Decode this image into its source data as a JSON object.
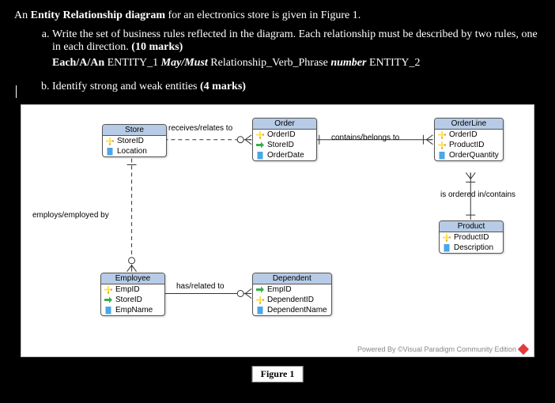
{
  "intro_prefix": "An ",
  "intro_bold": "Entity Relationship diagram",
  "intro_suffix": " for an electronics store is given in Figure 1.",
  "qa_text": "Write the set of business rules reflected in the diagram. Each relationship must be described by two rules, one in each direction. ",
  "qa_marks": "(10 marks)",
  "template_lead": "Each/A/An",
  "template_e1": " ENTITY_1 ",
  "template_verb_lead": "May/Must",
  "template_rest": " Relationship_Verb_Phrase ",
  "template_num": "number",
  "template_e2": " ENTITY_2",
  "qb_text": "Identify strong and weak entities ",
  "qb_marks": "(4 marks)",
  "chart_data": {
    "type": "diagram",
    "diagram_type": "Entity-Relationship",
    "title": "Figure 1",
    "entities": [
      {
        "name": "Store",
        "strength": "strong",
        "attributes": [
          {
            "name": "StoreID",
            "role": "PK"
          },
          {
            "name": "Location",
            "role": "attribute"
          }
        ]
      },
      {
        "name": "Order",
        "strength": "strong",
        "attributes": [
          {
            "name": "OrderID",
            "role": "PK"
          },
          {
            "name": "StoreID",
            "role": "FK"
          },
          {
            "name": "OrderDate",
            "role": "attribute"
          }
        ]
      },
      {
        "name": "OrderLine",
        "strength": "weak",
        "attributes": [
          {
            "name": "OrderID",
            "role": "PK/FK"
          },
          {
            "name": "ProductID",
            "role": "PK/FK"
          },
          {
            "name": "OrderQuantity",
            "role": "attribute"
          }
        ]
      },
      {
        "name": "Product",
        "strength": "strong",
        "attributes": [
          {
            "name": "ProductID",
            "role": "PK"
          },
          {
            "name": "Description",
            "role": "attribute"
          }
        ]
      },
      {
        "name": "Employee",
        "strength": "strong",
        "attributes": [
          {
            "name": "EmpID",
            "role": "PK"
          },
          {
            "name": "StoreID",
            "role": "FK"
          },
          {
            "name": "EmpName",
            "role": "attribute"
          }
        ]
      },
      {
        "name": "Dependent",
        "strength": "weak",
        "attributes": [
          {
            "name": "EmpID",
            "role": "PK/FK"
          },
          {
            "name": "DependentID",
            "role": "PK"
          },
          {
            "name": "DependentName",
            "role": "attribute"
          }
        ]
      }
    ],
    "relationships": [
      {
        "from": "Store",
        "to": "Order",
        "label": "receives/relates to",
        "identifying": false
      },
      {
        "from": "Order",
        "to": "OrderLine",
        "label": "contains/belongs to",
        "identifying": true
      },
      {
        "from": "Product",
        "to": "OrderLine",
        "label": "is ordered in/contains",
        "identifying": true
      },
      {
        "from": "Store",
        "to": "Employee",
        "label": "employs/employed by",
        "identifying": false
      },
      {
        "from": "Employee",
        "to": "Dependent",
        "label": "has/related to",
        "identifying": true
      }
    ]
  },
  "entities": {
    "store": {
      "name": "Store",
      "a0": "StoreID",
      "a1": "Location"
    },
    "order": {
      "name": "Order",
      "a0": "OrderID",
      "a1": "StoreID",
      "a2": "OrderDate"
    },
    "orderline": {
      "name": "OrderLine",
      "a0": "OrderID",
      "a1": "ProductID",
      "a2": "OrderQuantity"
    },
    "product": {
      "name": "Product",
      "a0": "ProductID",
      "a1": "Description"
    },
    "employee": {
      "name": "Employee",
      "a0": "EmpID",
      "a1": "StoreID",
      "a2": "EmpName"
    },
    "dependent": {
      "name": "Dependent",
      "a0": "EmpID",
      "a1": "DependentID",
      "a2": "DependentName"
    }
  },
  "rel_labels": {
    "store_order": "receives/relates to",
    "order_orderline": "contains/belongs to",
    "product_orderline": "is ordered in/contains",
    "store_employee": "employs/employed by",
    "employee_dependent": "has/related to"
  },
  "fig_caption": "Figure 1",
  "brand_text": "Powered By ©Visual Paradigm Community Edition"
}
